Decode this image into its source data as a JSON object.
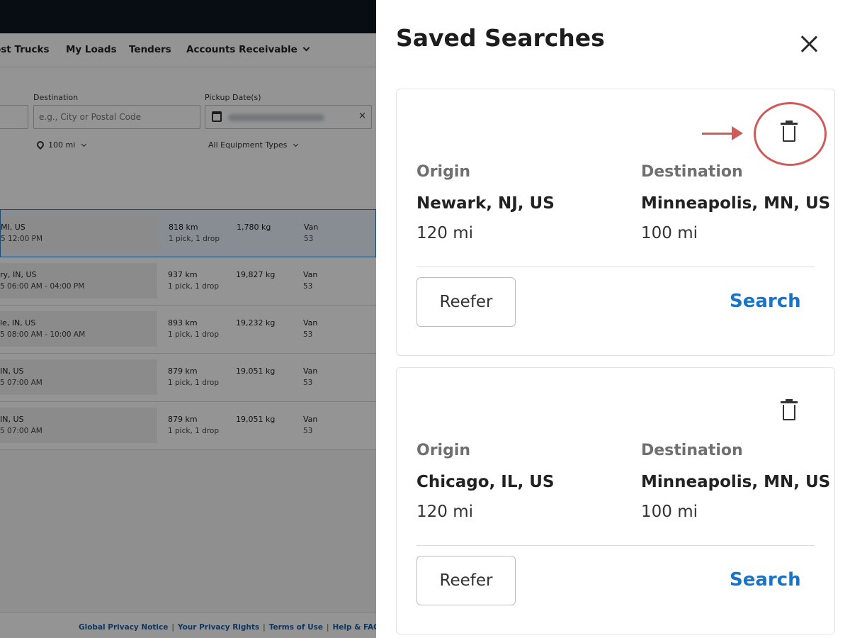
{
  "nav": {
    "items": [
      "ost Trucks",
      "My Loads",
      "Tenders",
      "Accounts Receivable"
    ]
  },
  "filters": {
    "destination_label": "Destination",
    "destination_placeholder": "e.g., City or Postal Code",
    "pickup_label": "Pickup Date(s)",
    "clear_symbol": "×",
    "radius_value": "100 mi",
    "equipment_value": "All Equipment Types"
  },
  "rows": [
    {
      "origin": "MI, US",
      "time": "5  12:00 PM",
      "distance": "818 km",
      "stops": "1 pick, 1 drop",
      "weight": "1,780 kg",
      "equipment": "Van",
      "length": "53"
    },
    {
      "origin": "ry, IN, US",
      "time": "5  06:00 AM - 04:00 PM",
      "distance": "937 km",
      "stops": "1 pick, 1 drop",
      "weight": "19,827 kg",
      "equipment": "Van",
      "length": "53"
    },
    {
      "origin": "le, IN, US",
      "time": "5  08:00 AM - 10:00 AM",
      "distance": "893 km",
      "stops": "1 pick, 1 drop",
      "weight": "19,232 kg",
      "equipment": "Van",
      "length": "53"
    },
    {
      "origin": "IN, US",
      "time": "5  07:00 AM",
      "distance": "879 km",
      "stops": "1 pick, 1 drop",
      "weight": "19,051 kg",
      "equipment": "Van",
      "length": "53"
    },
    {
      "origin": "IN, US",
      "time": "5  07:00 AM",
      "distance": "879 km",
      "stops": "1 pick, 1 drop",
      "weight": "19,051 kg",
      "equipment": "Van",
      "length": "53"
    }
  ],
  "footer": {
    "links": [
      "Global Privacy Notice",
      "Your Privacy Rights",
      "Terms of Use",
      "Help & FAQ"
    ],
    "separator": "|"
  },
  "drawer": {
    "title": "Saved Searches",
    "origin_label": "Origin",
    "destination_label": "Destination",
    "search_label": "Search",
    "cards": [
      {
        "origin": "Newark, NJ, US",
        "origin_radius": "120 mi",
        "destination": "Minneapolis, MN, US",
        "destination_radius": "100 mi",
        "equipment": "Reefer"
      },
      {
        "origin": "Chicago, IL, US",
        "origin_radius": "120 mi",
        "destination": "Minneapolis, MN, US",
        "destination_radius": "100 mi",
        "equipment": "Reefer"
      }
    ]
  },
  "colors": {
    "accent": "#1a73c5",
    "annotation": "#cf5a5a",
    "selected_row_border": "#2b83c9"
  }
}
